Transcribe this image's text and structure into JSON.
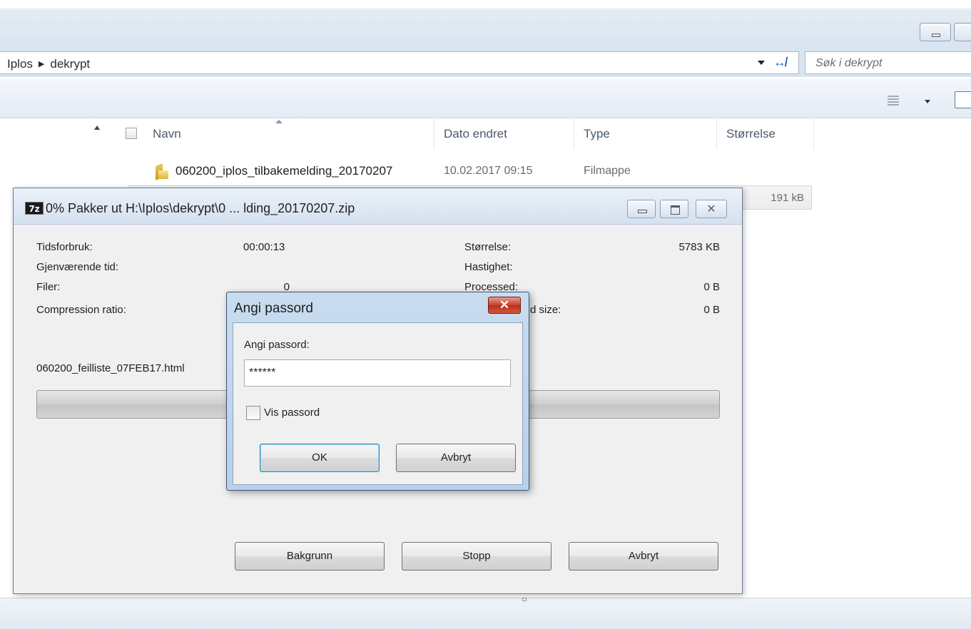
{
  "explorer": {
    "breadcrumb": [
      "Iplos",
      "dekrypt"
    ],
    "refresh_glyph": "↮",
    "search_placeholder": "Søk i dekrypt",
    "columns": [
      "Navn",
      "Dato endret",
      "Type",
      "Størrelse"
    ],
    "rows": [
      {
        "name": "060200_iplos_tilbakemelding_20170207",
        "date": "10.02.2017 09:15",
        "type": "Filmappe",
        "size": ""
      },
      {
        "name": "",
        "date": "",
        "type": "",
        "size": "191 kB"
      }
    ],
    "icons": [
      "folder-icon",
      "view-details-icon",
      "refresh-icon"
    ]
  },
  "zip_dialog": {
    "logo": "7z",
    "title": "0% Pakker ut H:\\Iplos\\dekrypt\\0 ... lding_20170207.zip",
    "progress_fraction": 0,
    "stats_left": [
      {
        "label": "Tidsforbruk:",
        "value": "00:00:13"
      },
      {
        "label": "Gjenværende tid:",
        "value": ""
      },
      {
        "label": "Filer:",
        "value": "0"
      },
      {
        "label": "Compression ratio:",
        "value": ""
      }
    ],
    "stats_right": [
      {
        "label": "Størrelse:",
        "value": "5783 KB"
      },
      {
        "label": "Hastighet:",
        "value": ""
      },
      {
        "label": "Processed:",
        "value": "0 B"
      },
      {
        "label": "d size:",
        "value": "0 B"
      }
    ],
    "current_file": "060200_feilliste_07FEB17.html",
    "buttons": {
      "background": "Bakgrunn",
      "stop": "Stopp",
      "cancel": "Avbryt"
    },
    "close_glyph": "✕"
  },
  "password_dialog": {
    "title": "Angi passord",
    "close_glyph": "✕",
    "prompt": "Angi passord:",
    "password_masked": "******",
    "show_password_label": "Vis passord",
    "show_password_checked": false,
    "ok_label": "OK",
    "cancel_label": "Avbryt"
  }
}
